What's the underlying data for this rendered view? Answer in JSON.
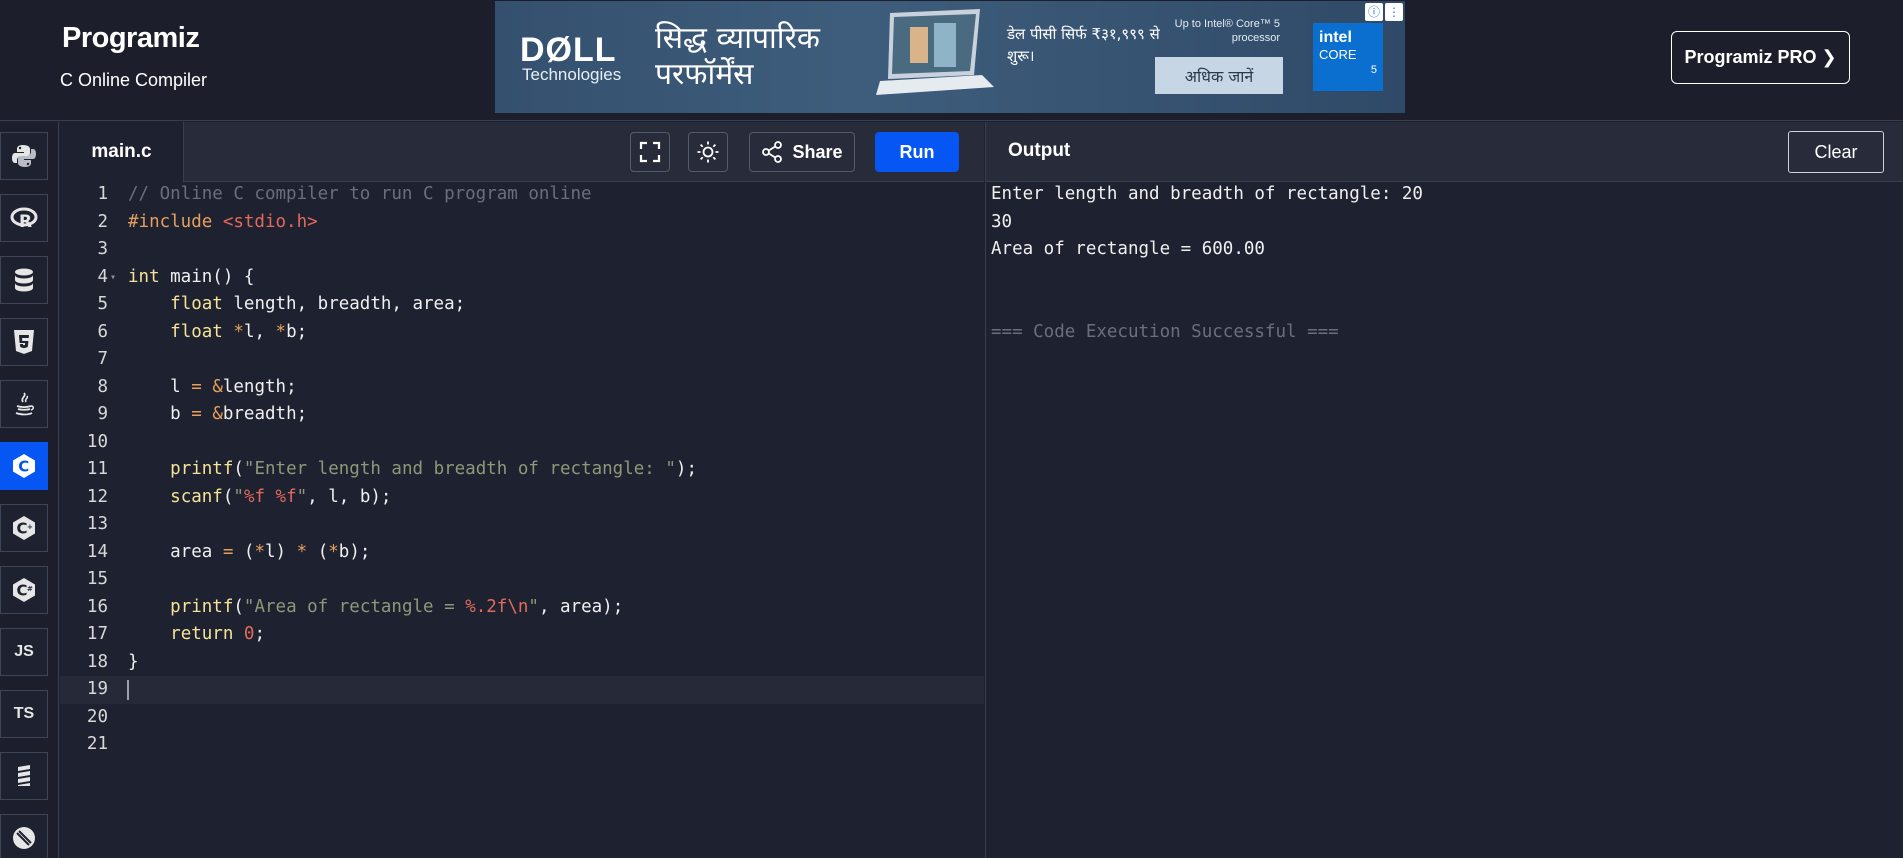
{
  "header": {
    "logo": "Programiz",
    "subtitle": "C Online Compiler",
    "pro_button": "Programiz PRO ❯"
  },
  "ad": {
    "brand": "DØLL",
    "brand_sub": "Technologies",
    "headline": "सिद्ध व्यापारिक परफॉर्मेंस",
    "price": "डेल पीसी सिर्फ ₹३१,९९९ से शुरू।",
    "processor": "Up to Intel® Core™ 5 processor",
    "cta": "अधिक जानें",
    "intel_logo": "intel",
    "intel_core": "CORE",
    "intel_num": "5"
  },
  "sidebar": {
    "items": [
      {
        "name": "python",
        "label": "",
        "active": false
      },
      {
        "name": "r",
        "label": "R",
        "active": false
      },
      {
        "name": "sql",
        "label": "",
        "active": false
      },
      {
        "name": "html",
        "label": "5",
        "active": false
      },
      {
        "name": "java",
        "label": "",
        "active": false
      },
      {
        "name": "c",
        "label": "C",
        "active": true
      },
      {
        "name": "cpp",
        "label": "C",
        "active": false
      },
      {
        "name": "csharp",
        "label": "C",
        "active": false
      },
      {
        "name": "js",
        "label": "JS",
        "active": false
      },
      {
        "name": "ts",
        "label": "TS",
        "active": false
      },
      {
        "name": "go",
        "label": "",
        "active": false
      },
      {
        "name": "swift",
        "label": "",
        "active": false
      }
    ]
  },
  "editor": {
    "file_name": "main.c",
    "share_label": "Share",
    "run_label": "Run",
    "current_line": 19,
    "lines": [
      {
        "n": "1",
        "tokens": [
          [
            "com",
            "// Online C compiler to run C program online"
          ]
        ]
      },
      {
        "n": "2",
        "tokens": [
          [
            "pre",
            "#include "
          ],
          [
            "inc",
            "<stdio.h>"
          ]
        ]
      },
      {
        "n": "3",
        "tokens": []
      },
      {
        "n": "4",
        "fold": true,
        "tokens": [
          [
            "kw",
            "int"
          ],
          [
            "",
            " main() {"
          ]
        ]
      },
      {
        "n": "5",
        "tokens": [
          [
            "",
            "    "
          ],
          [
            "kw",
            "float"
          ],
          [
            "",
            " length, breadth, area;"
          ]
        ]
      },
      {
        "n": "6",
        "tokens": [
          [
            "",
            "    "
          ],
          [
            "kw",
            "float"
          ],
          [
            "",
            " "
          ],
          [
            "op",
            "*"
          ],
          [
            "",
            "l, "
          ],
          [
            "op",
            "*"
          ],
          [
            "",
            "b;"
          ]
        ]
      },
      {
        "n": "7",
        "tokens": []
      },
      {
        "n": "8",
        "tokens": [
          [
            "",
            "    l "
          ],
          [
            "op",
            "="
          ],
          [
            "",
            " "
          ],
          [
            "op",
            "&"
          ],
          [
            "",
            "length;"
          ]
        ]
      },
      {
        "n": "9",
        "tokens": [
          [
            "",
            "    b "
          ],
          [
            "op",
            "="
          ],
          [
            "",
            " "
          ],
          [
            "op",
            "&"
          ],
          [
            "",
            "breadth;"
          ]
        ]
      },
      {
        "n": "10",
        "tokens": []
      },
      {
        "n": "11",
        "tokens": [
          [
            "",
            "    "
          ],
          [
            "fn",
            "printf"
          ],
          [
            "",
            "("
          ],
          [
            "str",
            "\"Enter length and breadth of rectangle: \""
          ],
          [
            "",
            ");"
          ]
        ]
      },
      {
        "n": "12",
        "tokens": [
          [
            "",
            "    "
          ],
          [
            "fn",
            "scanf"
          ],
          [
            "",
            "("
          ],
          [
            "str",
            "\""
          ],
          [
            "esc",
            "%f %f"
          ],
          [
            "str",
            "\""
          ],
          [
            "",
            ", l, b);"
          ]
        ]
      },
      {
        "n": "13",
        "tokens": []
      },
      {
        "n": "14",
        "tokens": [
          [
            "",
            "    area "
          ],
          [
            "op",
            "="
          ],
          [
            "",
            " ("
          ],
          [
            "op",
            "*"
          ],
          [
            "",
            "l) "
          ],
          [
            "op",
            "*"
          ],
          [
            "",
            " ("
          ],
          [
            "op",
            "*"
          ],
          [
            "",
            "b);"
          ]
        ]
      },
      {
        "n": "15",
        "tokens": []
      },
      {
        "n": "16",
        "tokens": [
          [
            "",
            "    "
          ],
          [
            "fn",
            "printf"
          ],
          [
            "",
            "("
          ],
          [
            "str",
            "\"Area of rectangle = "
          ],
          [
            "esc",
            "%.2f\\n"
          ],
          [
            "str",
            "\""
          ],
          [
            "",
            ", area);"
          ]
        ]
      },
      {
        "n": "17",
        "tokens": [
          [
            "",
            "    "
          ],
          [
            "kw",
            "return"
          ],
          [
            "",
            " "
          ],
          [
            "num",
            "0"
          ],
          [
            "",
            ";"
          ]
        ]
      },
      {
        "n": "18",
        "tokens": [
          [
            "",
            "}"
          ]
        ]
      },
      {
        "n": "19",
        "tokens": []
      },
      {
        "n": "20",
        "tokens": []
      },
      {
        "n": "21",
        "tokens": []
      }
    ]
  },
  "output": {
    "title": "Output",
    "clear_label": "Clear",
    "lines": [
      {
        "text": "Enter length and breadth of rectangle: 20",
        "muted": false
      },
      {
        "text": "30",
        "muted": false
      },
      {
        "text": "Area of rectangle = 600.00",
        "muted": false
      },
      {
        "text": "",
        "muted": false
      },
      {
        "text": "",
        "muted": false
      },
      {
        "text": "=== Code Execution Successful ===",
        "muted": true
      }
    ]
  }
}
